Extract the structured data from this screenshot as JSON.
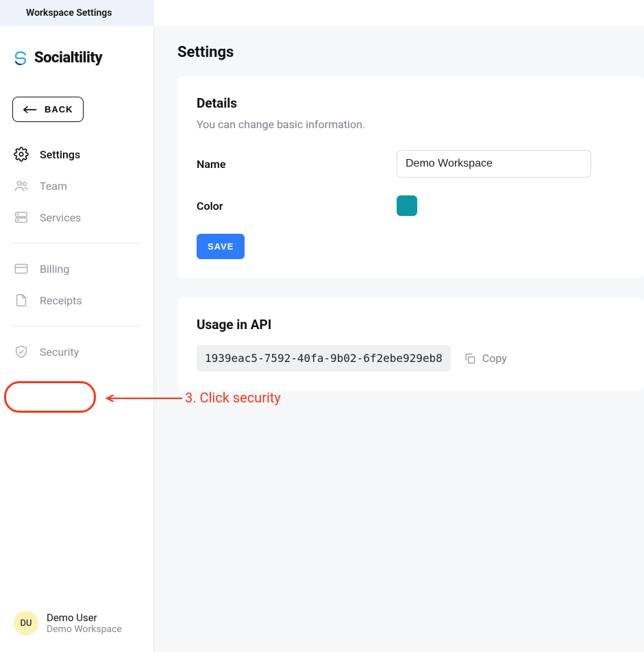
{
  "topbar": {
    "title": "Workspace Settings"
  },
  "brand": {
    "name": "Socialtility"
  },
  "back": {
    "label": "BACK"
  },
  "sidebar": {
    "items": [
      {
        "label": "Settings"
      },
      {
        "label": "Team"
      },
      {
        "label": "Services"
      },
      {
        "label": "Billing"
      },
      {
        "label": "Receipts"
      },
      {
        "label": "Security"
      }
    ]
  },
  "user": {
    "initials": "DU",
    "name": "Demo User",
    "workspace": "Demo Workspace"
  },
  "page": {
    "title": "Settings"
  },
  "details": {
    "heading": "Details",
    "subtitle": "You can change basic information.",
    "name_label": "Name",
    "name_value": "Demo Workspace",
    "color_label": "Color",
    "color_value": "#0d97a6",
    "save_label": "SAVE"
  },
  "api": {
    "heading": "Usage in API",
    "key": "1939eac5-7592-40fa-9b02-6f2ebe929eb8",
    "copy_label": "Copy"
  },
  "annotation": {
    "text": "3. Click security"
  }
}
